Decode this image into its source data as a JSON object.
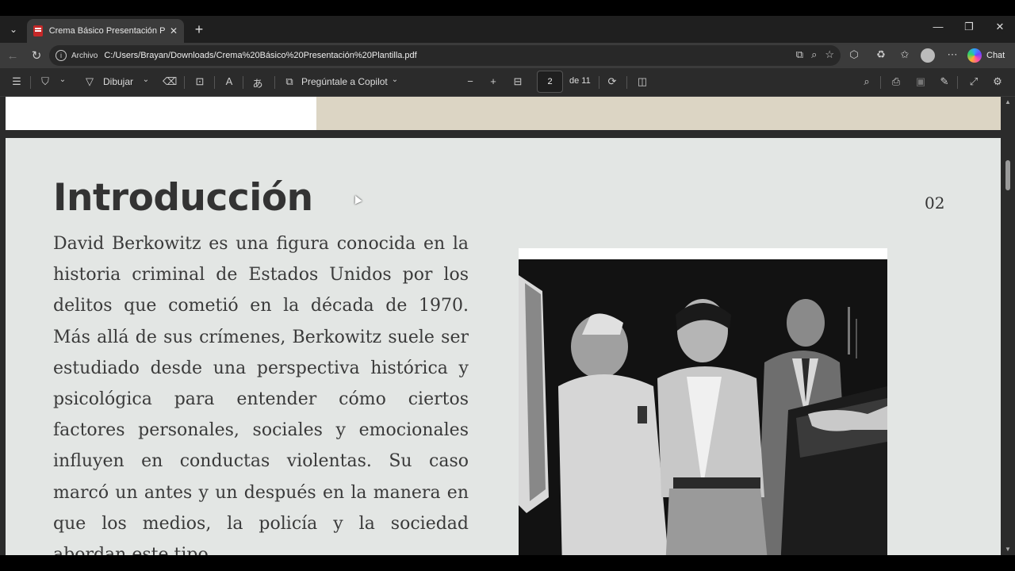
{
  "browser": {
    "tab_title": "Crema Básico Presentación Plantilla",
    "address_label": "Archivo",
    "url": "C:/Users/Brayan/Downloads/Crema%20Básico%20Presentación%20Plantilla.pdf",
    "chat_label": "Chat"
  },
  "pdf_toolbar": {
    "draw_label": "Dibujar",
    "copilot_label": "Pregúntale a Copilot",
    "page_current": "2",
    "page_total": "de 11"
  },
  "document": {
    "heading": "Introducción",
    "page_number": "02",
    "paragraph": "David Berkowitz es una figura conocida en la historia criminal de Estados Unidos por los delitos que cometió en la década de 1970. Más allá de sus crímenes, Berkowitz suele ser estudiado desde una perspectiva histórica y psicológica para entender cómo ciertos factores personales, sociales y emocionales influyen en conductas violentas. Su caso marcó un antes y un después en la manera en que los medios, la policía y la sociedad abordan este tipo"
  },
  "colors": {
    "page_bg": "#e3e6e4",
    "prev_page_beige": "#dcd5c4",
    "text": "#333333"
  }
}
